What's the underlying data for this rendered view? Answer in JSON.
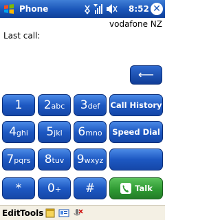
{
  "title_bar": {
    "app_title": "Phone",
    "time": "8:52",
    "close_label": "✕"
  },
  "status": {
    "carrier": "vodafone NZ",
    "last_call_label": "Last call:",
    "number_value": ""
  },
  "keypad": {
    "backspace_label": "⟵",
    "keys": [
      {
        "num": "1",
        "letters": ""
      },
      {
        "num": "2",
        "letters": "abc"
      },
      {
        "num": "3",
        "letters": "def"
      },
      {
        "num": "4",
        "letters": "ghi"
      },
      {
        "num": "5",
        "letters": "jkl"
      },
      {
        "num": "6",
        "letters": "mno"
      },
      {
        "num": "7",
        "letters": "pqrs"
      },
      {
        "num": "8",
        "letters": "tuv"
      },
      {
        "num": "9",
        "letters": "wxyz"
      },
      {
        "num": "*",
        "letters": ""
      },
      {
        "num": "0",
        "letters": "+"
      },
      {
        "num": "#",
        "letters": ""
      }
    ],
    "call_history_label": "Call History",
    "speed_dial_label": "Speed Dial",
    "talk_label": "Talk"
  },
  "menu": {
    "edit_label": "Edit",
    "tools_label": "Tools"
  },
  "colors": {
    "title_bar": "#1a55b8",
    "key_blue": "#1d58c2",
    "talk_green": "#2f9a33",
    "menu_bar": "#f4f0e4"
  }
}
